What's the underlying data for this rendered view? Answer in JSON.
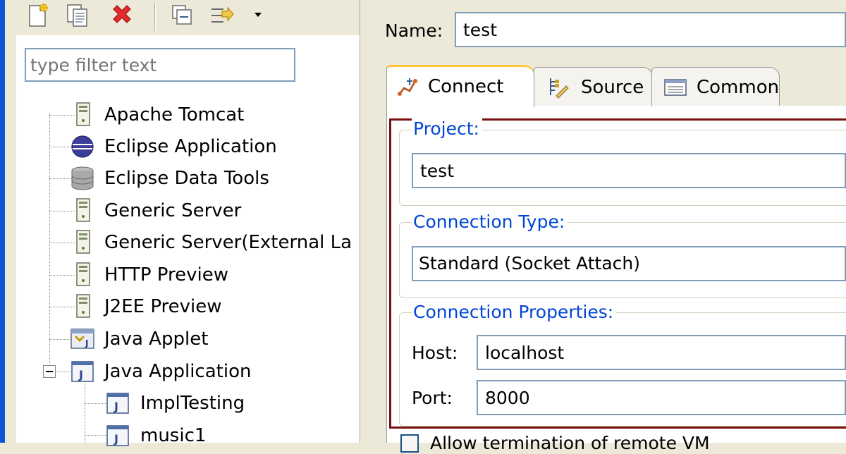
{
  "toolbar": {
    "icons": [
      "new-config-icon",
      "duplicate-config-icon",
      "delete-config-icon",
      "collapse-all-icon",
      "filter-icon",
      "dropdown-arrow-icon"
    ]
  },
  "filter": {
    "placeholder": "type filter text"
  },
  "tree": {
    "items": [
      {
        "label": "Apache Tomcat",
        "icon": "server-icon"
      },
      {
        "label": "Eclipse Application",
        "icon": "eclipse-icon"
      },
      {
        "label": "Eclipse Data Tools",
        "icon": "database-icon"
      },
      {
        "label": "Generic Server",
        "icon": "server-icon"
      },
      {
        "label": "Generic Server(External La",
        "icon": "server-icon"
      },
      {
        "label": "HTTP Preview",
        "icon": "server-icon"
      },
      {
        "label": "J2EE Preview",
        "icon": "server-icon"
      },
      {
        "label": "Java Applet",
        "icon": "java-applet-icon"
      },
      {
        "label": "Java Application",
        "icon": "java-app-icon",
        "expanded": true
      },
      {
        "label": "ImplTesting",
        "icon": "java-app-icon",
        "child": true
      },
      {
        "label": "music1",
        "icon": "java-app-icon",
        "child": true
      }
    ]
  },
  "config": {
    "name_label": "Name:",
    "name_value": "test"
  },
  "tabs": [
    {
      "label": "Connect",
      "icon": "connect-icon",
      "active": true
    },
    {
      "label": "Source",
      "icon": "source-icon",
      "active": false
    },
    {
      "label": "Common",
      "icon": "common-icon",
      "active": false
    }
  ],
  "connect": {
    "project": {
      "legend": "Project:",
      "value": "test"
    },
    "connection_type": {
      "legend": "Connection Type:",
      "selected": "Standard (Socket Attach)"
    },
    "properties": {
      "legend": "Connection Properties:",
      "host_label": "Host:",
      "host_value": "localhost",
      "port_label": "Port:",
      "port_value": "8000"
    },
    "allow_termination": {
      "label": "Allow termination of remote VM",
      "checked": false
    }
  },
  "colors": {
    "legend_blue": "#0046d5",
    "focus_frame": "#7a0f0f",
    "window_blue": "#0a56d6",
    "field_border": "#7f9db9"
  }
}
